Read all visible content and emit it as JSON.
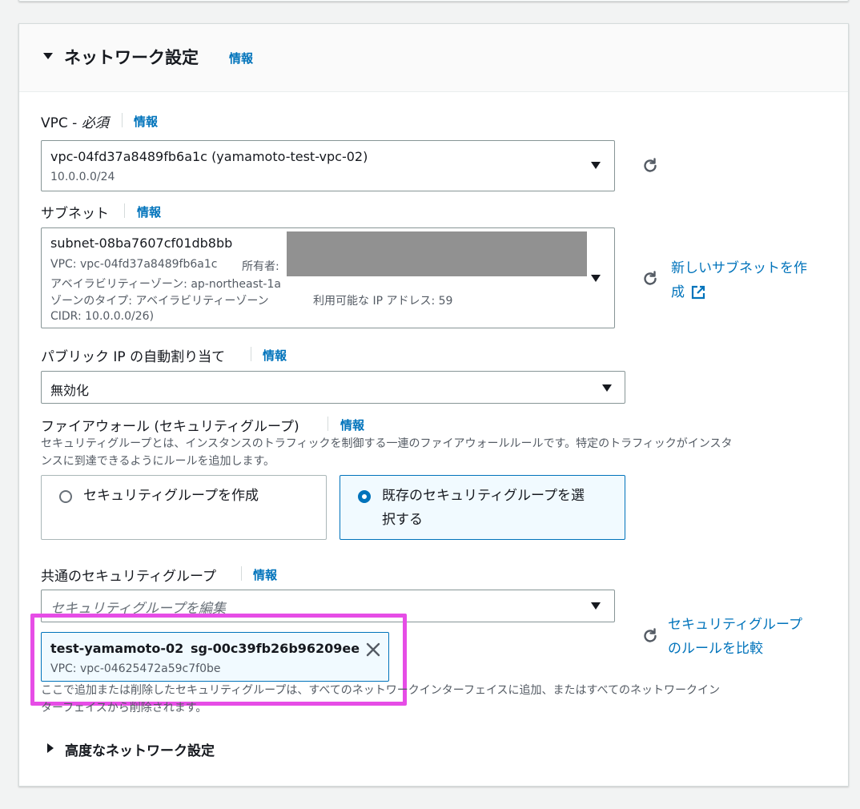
{
  "section": {
    "title": "ネットワーク設定",
    "info": "情報"
  },
  "vpc": {
    "label": "VPC - ",
    "required": "必須",
    "info": "情報",
    "value": "vpc-04fd37a8489fb6a1c (yamamoto-test-vpc-02)",
    "cidr": "10.0.0.0/24"
  },
  "subnet": {
    "label": "サブネット",
    "info": "情報",
    "value": "subnet-08ba7607cf01db8bb",
    "line1_vpc": "VPC: vpc-04fd37a8489fb6a1c",
    "line1_owner": "所有者:",
    "line2": "アベイラビリティーゾーン: ap-northeast-1a",
    "line3_zone": "ゾーンのタイプ: アベイラビリティーゾーン",
    "line3_ip": "利用可能な IP アドレス: 59",
    "line4": "CIDR: 10.0.0.0/26)",
    "create_link_1": "新しいサブネットを作",
    "create_link_2": "成"
  },
  "public_ip": {
    "label": "パブリック IP の自動割り当て",
    "info": "情報",
    "value": "無効化"
  },
  "firewall": {
    "label": "ファイアウォール (セキュリティグループ)",
    "info": "情報",
    "desc_1": "セキュリティグループとは、インスタンスのトラフィックを制御する一連のファイアウォールルールです。特定のトラフィックがインスタ",
    "desc_2": "ンスに到達できるようにルールを追加します。",
    "option_create": "セキュリティグループを作成",
    "option_existing_1": "既存のセキュリティグループを選",
    "option_existing_2": "択する"
  },
  "common_sg": {
    "label": "共通のセキュリティグループ",
    "info": "情報",
    "placeholder": "セキュリティグループを編集",
    "token_name": "test-yamamoto-02",
    "token_id": "sg-00c39fb26b96209ee",
    "token_vpc": "VPC: vpc-04625472a59c7f0be",
    "compare_link_1": "セキュリティグループ",
    "compare_link_2": "のルールを比較",
    "note_1": "ここで追加または削除したセキュリティグループは、すべてのネットワークインターフェイスに追加、またはすべてのネットワークイン",
    "note_2": "ターフェイスから削除されます。"
  },
  "advanced": {
    "title": "高度なネットワーク設定"
  },
  "colors": {
    "link": "#0073bb",
    "highlight": "#e64de6",
    "redaction": "#919191"
  }
}
